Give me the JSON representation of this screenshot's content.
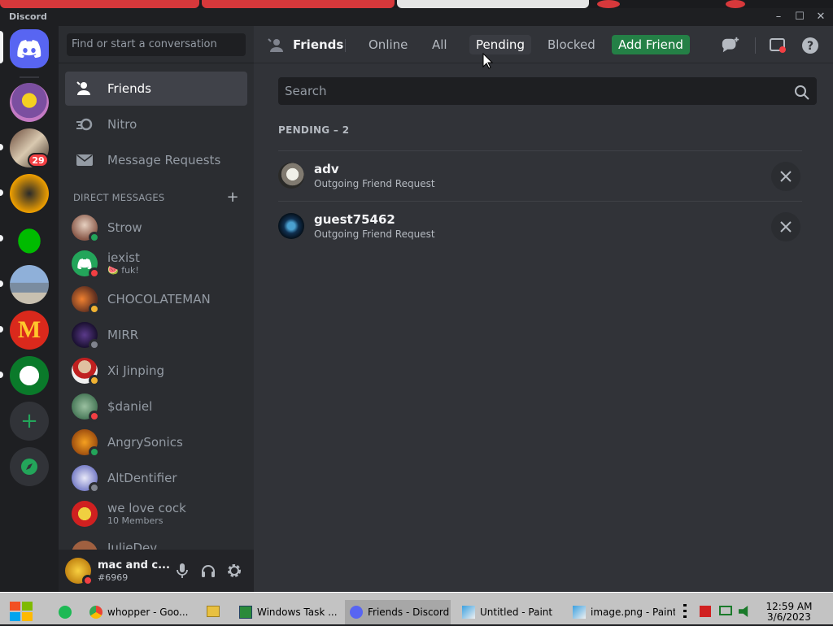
{
  "window": {
    "title": "Discord",
    "minimize": "–",
    "maximize": "☐",
    "close": "✕"
  },
  "guilds": {
    "add_server_label": "+",
    "badge": "29"
  },
  "dm_search": {
    "placeholder": "Find or start a conversation"
  },
  "nav": [
    {
      "label": "Friends",
      "icon": "friends-icon"
    },
    {
      "label": "Nitro",
      "icon": "nitro-icon"
    },
    {
      "label": "Message Requests",
      "icon": "envelope-icon"
    }
  ],
  "direct_messages_header": "DIRECT MESSAGES",
  "direct_messages_add": "+",
  "dms": [
    {
      "name": "Strow",
      "sub": "",
      "status": "online"
    },
    {
      "name": "iexist",
      "sub": "🍉 fuk!",
      "status": "dnd"
    },
    {
      "name": "CHOCOLATEMAN",
      "sub": "",
      "status": "idle"
    },
    {
      "name": "MIRR",
      "sub": "",
      "status": "offline"
    },
    {
      "name": "Xi Jinping",
      "sub": "",
      "status": "idle"
    },
    {
      "name": "$daniel",
      "sub": "",
      "status": "dnd"
    },
    {
      "name": "AngrySonics",
      "sub": "",
      "status": "online"
    },
    {
      "name": "AltDentifier",
      "sub": "",
      "status": "offline"
    },
    {
      "name": "we love cock",
      "sub": "10 Members",
      "status": ""
    },
    {
      "name": "JulieDev",
      "sub": "",
      "status": ""
    }
  ],
  "user": {
    "name": "mac and c...",
    "tag": "#6969",
    "status": "dnd"
  },
  "header": {
    "title": "Friends",
    "tabs": [
      "Online",
      "All",
      "Pending",
      "Blocked"
    ],
    "active_tab": "Pending",
    "add_friend": "Add Friend"
  },
  "search": {
    "placeholder": "Search"
  },
  "pending": {
    "heading": "PENDING – 2",
    "requests": [
      {
        "name": "adv",
        "sub": "Outgoing Friend Request"
      },
      {
        "name": "guest75462",
        "sub": "Outgoing Friend Request"
      }
    ]
  },
  "taskbar": {
    "items": [
      {
        "label": "whopper - Goo...",
        "icon": "chrome-icon"
      },
      {
        "label": "Windows Task ...",
        "icon": "task-manager-icon"
      },
      {
        "label": "Friends - Discord",
        "icon": "discord-icon"
      },
      {
        "label": "Untitled - Paint",
        "icon": "paint-icon"
      },
      {
        "label": "image.png - Paint",
        "icon": "paint-icon"
      }
    ],
    "time": "12:59 AM",
    "date": "3/6/2023"
  },
  "colors": {
    "accent": "#5865f2",
    "add_friend": "#248046",
    "online": "#23a55a",
    "dnd": "#f23f43",
    "idle": "#f0b232",
    "offline": "#80848e"
  }
}
